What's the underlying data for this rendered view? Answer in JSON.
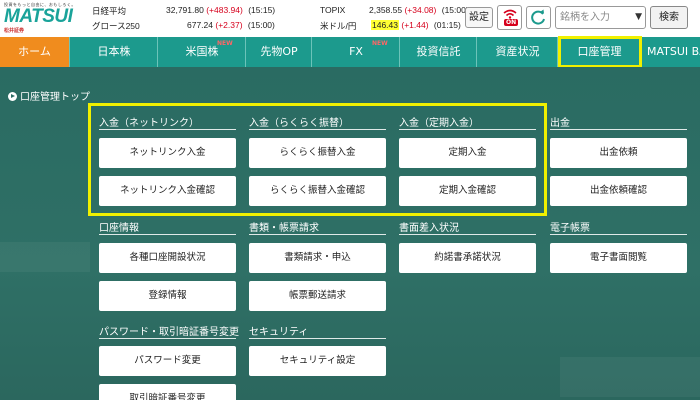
{
  "logo": {
    "slogan": "投資をもっと自由に、おもしろく。",
    "main": "MATSUI",
    "sub": "松井証券"
  },
  "market": {
    "nikkei": {
      "name": "日経平均",
      "value": "32,791.80",
      "change": "(+483.94)",
      "time": "(15:15)"
    },
    "topix": {
      "name": "TOPIX",
      "value": "2,358.55",
      "change": "(+34.08)",
      "time": "(15:00)"
    },
    "growth": {
      "name": "グロース250",
      "value": "677.24",
      "change": "(+2.37)",
      "time": "(15:00)"
    },
    "usdjpy": {
      "name": "米ドル/円",
      "value": "146.43",
      "change": "(+1.44)",
      "time": "(01:15)"
    }
  },
  "toolbar": {
    "settings_label": "設定",
    "on_label": "ON",
    "search_placeholder": "銘柄を入力",
    "search_button": "検索"
  },
  "nav": {
    "items": [
      {
        "label": "ホーム"
      },
      {
        "label": "日本株"
      },
      {
        "label": "米国株",
        "badge": "NEW"
      },
      {
        "label": "先物OP"
      },
      {
        "label": "FX",
        "badge": "NEW"
      },
      {
        "label": "投資信託"
      },
      {
        "label": "資産状況"
      },
      {
        "label": "口座管理"
      },
      {
        "label": "MATSUI BA"
      }
    ]
  },
  "page": {
    "breadcrumb": "口座管理トップ"
  },
  "sections": {
    "netlink": {
      "title": "入金（ネットリンク）",
      "buttons": [
        "ネットリンク入金",
        "ネットリンク入金確認"
      ]
    },
    "rakuraku": {
      "title": "入金（らくらく振替）",
      "buttons": [
        "らくらく振替入金",
        "らくらく振替入金確認"
      ]
    },
    "teiki": {
      "title": "入金（定期入金）",
      "buttons": [
        "定期入金",
        "定期入金確認"
      ]
    },
    "shukkin": {
      "title": "出金",
      "buttons": [
        "出金依頼",
        "出金依頼確認"
      ]
    },
    "kouza": {
      "title": "口座情報",
      "buttons": [
        "各種口座開設状況",
        "登録情報"
      ]
    },
    "shorui": {
      "title": "書類・帳票請求",
      "buttons": [
        "書類請求・申込",
        "帳票郵送請求"
      ]
    },
    "shomen": {
      "title": "書面差入状況",
      "buttons": [
        "約諾書承諾状況"
      ]
    },
    "denshi": {
      "title": "電子帳票",
      "buttons": [
        "電子書面閲覧"
      ]
    },
    "password": {
      "title": "パスワード・取引暗証番号変更",
      "buttons": [
        "パスワード変更",
        "取引暗証番号変更"
      ]
    },
    "security": {
      "title": "セキュリティ",
      "buttons": [
        "セキュリティ設定"
      ]
    }
  }
}
